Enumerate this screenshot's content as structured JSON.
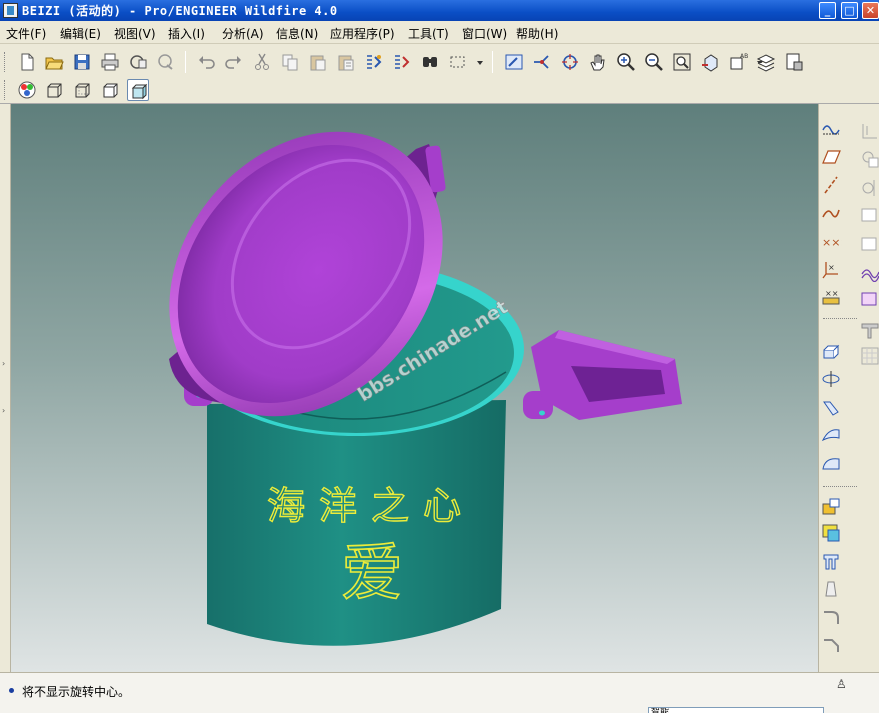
{
  "window": {
    "title": "BEIZI (活动的) - Pro/ENGINEER Wildfire 4.0",
    "controls": {
      "minimize": "_",
      "maximize": "□",
      "close": "✕"
    }
  },
  "menu": [
    "文件(F)",
    "编辑(E)",
    "视图(V)",
    "插入(I)",
    "分析(A)",
    "信息(N)",
    "应用程序(P)",
    "工具(T)",
    "窗口(W)",
    "帮助(H)"
  ],
  "toolbar_top": [
    {
      "icon": "new-file-icon"
    },
    {
      "icon": "open-folder-icon"
    },
    {
      "icon": "save-icon"
    },
    {
      "icon": "print-icon"
    },
    {
      "icon": "send-email-icon"
    },
    {
      "icon": "send-link-icon"
    },
    {
      "icon": "undo-icon"
    },
    {
      "icon": "redo-icon"
    },
    {
      "icon": "cut-icon"
    },
    {
      "icon": "copy-icon"
    },
    {
      "icon": "paste-icon"
    },
    {
      "icon": "paste-special-icon"
    },
    {
      "icon": "regenerate-icon"
    },
    {
      "icon": "regen-manager-icon"
    },
    {
      "icon": "find-icon"
    },
    {
      "icon": "selection-box-icon"
    },
    {
      "icon": "repaint-icon"
    },
    {
      "icon": "spin-center-icon"
    },
    {
      "icon": "orient-mode-icon"
    },
    {
      "icon": "pan-hand-icon"
    },
    {
      "icon": "zoom-in-icon"
    },
    {
      "icon": "zoom-out-icon"
    },
    {
      "icon": "refit-icon"
    },
    {
      "icon": "reorient-icon"
    },
    {
      "icon": "saved-views-icon"
    },
    {
      "icon": "layers-icon"
    },
    {
      "icon": "view-manager-icon"
    }
  ],
  "toolbar_display": [
    {
      "icon": "appearance-icon"
    },
    {
      "icon": "wireframe-icon"
    },
    {
      "icon": "hidden-line-icon"
    },
    {
      "icon": "no-hidden-icon"
    },
    {
      "icon": "shading-icon"
    }
  ],
  "toolbar_right": [
    {
      "icon": "datum-plane-display-icon"
    },
    {
      "icon": "datum-plane-tool-icon"
    },
    {
      "icon": "datum-axis-tool-icon"
    },
    {
      "icon": "datum-curve-tool-icon"
    },
    {
      "icon": "datum-point-tool-icon"
    },
    {
      "icon": "coordinate-system-tool-icon"
    },
    {
      "icon": "analysis-feature-icon"
    },
    {
      "icon": "extrude-tool-icon"
    },
    {
      "icon": "revolve-tool-icon"
    },
    {
      "icon": "variable-section-sweep-icon"
    },
    {
      "icon": "boundary-blend-icon"
    },
    {
      "icon": "style-tool-icon"
    },
    {
      "icon": "hole-tool-icon"
    },
    {
      "icon": "shell-tool-icon"
    },
    {
      "icon": "rib-tool-icon"
    },
    {
      "icon": "draft-tool-icon"
    },
    {
      "icon": "round-tool-icon"
    },
    {
      "icon": "chamfer-tool-icon"
    }
  ],
  "model": {
    "watermark": "bbs.chinade.net",
    "engraving_top": "海洋之心",
    "engraving_main": "爱",
    "colors": {
      "lid": "#a53ecb",
      "body": "#1e8f85",
      "rim": "#36d4cc",
      "engraving": "#ecec3a"
    }
  },
  "status": {
    "message": "将不显示旋转中心。",
    "filter_value": "智能"
  }
}
